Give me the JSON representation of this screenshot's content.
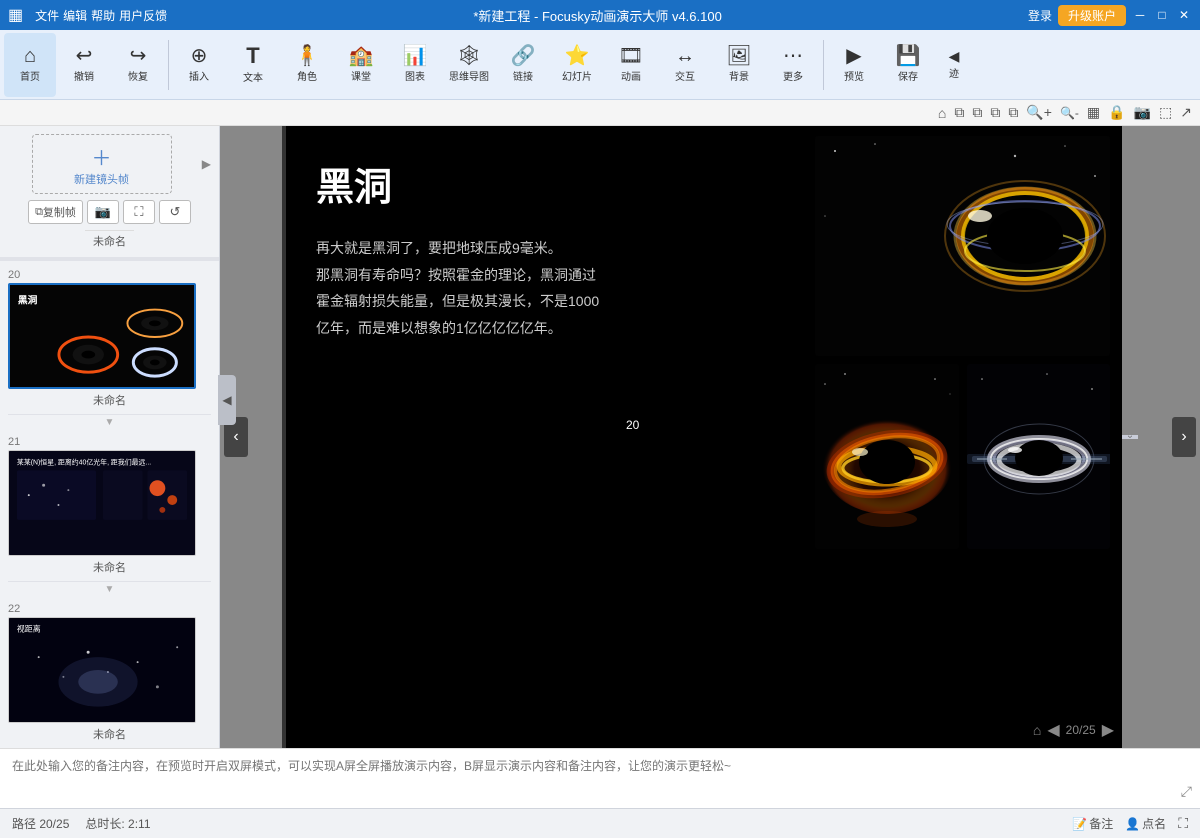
{
  "titlebar": {
    "icon": "▦",
    "title": "*新建工程 - Focusky动画演示大师  v4.6.100",
    "login": "登录",
    "upgrade": "升级账户",
    "min": "─",
    "max": "□",
    "close": "✕"
  },
  "menubar": {
    "items": [
      "文件",
      "编辑",
      "帮助",
      "用户反馈"
    ]
  },
  "toolbar": {
    "home": {
      "label": "首页",
      "icon": "⌂"
    },
    "undo": {
      "label": "撤销",
      "icon": "↩"
    },
    "redo": {
      "label": "恢复",
      "icon": "↪"
    },
    "insert": {
      "label": "插入",
      "icon": "⊕"
    },
    "text": {
      "label": "文本",
      "icon": "T"
    },
    "character": {
      "label": "角色",
      "icon": "👤"
    },
    "classroom": {
      "label": "课堂",
      "icon": "🏫"
    },
    "chart": {
      "label": "图表",
      "icon": "📊"
    },
    "mindmap": {
      "label": "思维导图",
      "icon": "🔗"
    },
    "link": {
      "label": "链接",
      "icon": "🔗"
    },
    "slideshow": {
      "label": "幻灯片",
      "icon": "⭐"
    },
    "animation": {
      "label": "动画",
      "icon": "🎬"
    },
    "interact": {
      "label": "交互",
      "icon": "↔"
    },
    "background": {
      "label": "背景",
      "icon": "🖼"
    },
    "more": {
      "label": "更多",
      "icon": "⋯"
    },
    "preview": {
      "label": "预览",
      "icon": "▶"
    },
    "save": {
      "label": "保存",
      "icon": "💾"
    },
    "nav": {
      "label": "迹",
      "icon": "←"
    }
  },
  "slide": {
    "title": "黑洞",
    "text": "再大就是黑洞了，要把地球压成9毫米。\n那黑洞有寿命吗？按照霍金的理论，黑洞通过\n霍金辐射损失能量，但是极其漫长，不是1000\n亿年，而是难以想象的1亿亿亿亿亿年。",
    "frame_number": "20"
  },
  "slides": [
    {
      "number": "20",
      "name": "未命名",
      "active": true
    },
    {
      "number": "21",
      "name": "未命名",
      "active": false
    },
    {
      "number": "22",
      "name": "未命名",
      "active": false
    }
  ],
  "sidebar": {
    "new_frame_label": "新建镜头帧",
    "copy_btn": "复制帧",
    "unnamed": "未命名",
    "collapse_icon": "▼"
  },
  "notes": {
    "placeholder": "在此处输入您的备注内容，在预览时开启双屏模式，可以实现A屏全屏播放演示内容，B屏显示演示内容和备注内容，让您的演示更轻松~"
  },
  "statusbar": {
    "path": "路径 20/25",
    "duration": "总时长: 2:11",
    "notes_btn": "备注",
    "pointname_btn": "点名",
    "page_info": "20/25"
  },
  "subtoolbar": {
    "icons": [
      "⌂",
      "⧉",
      "⧉",
      "⧉",
      "⧉",
      "⊕",
      "⊖",
      "▦",
      "🔒",
      "📷",
      "⬚",
      "↗"
    ]
  }
}
